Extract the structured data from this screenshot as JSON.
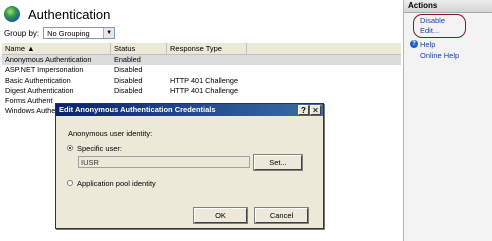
{
  "header": {
    "title": "Authentication",
    "icon": "globe-icon"
  },
  "toolbar": {
    "group_by_label": "Group by:",
    "group_by_value": "No Grouping"
  },
  "table": {
    "columns": [
      "Name",
      "Status",
      "Response Type"
    ],
    "rows": [
      {
        "name": "Anonymous Authentication",
        "status": "Enabled",
        "response": ""
      },
      {
        "name": "ASP.NET Impersonation",
        "status": "Disabled",
        "response": ""
      },
      {
        "name": "Basic Authentication",
        "status": "Disabled",
        "response": "HTTP 401 Challenge"
      },
      {
        "name": "Digest Authentication",
        "status": "Disabled",
        "response": "HTTP 401 Challenge"
      },
      {
        "name": "Forms Authent",
        "status": "",
        "response": ""
      },
      {
        "name": "Windows Authe",
        "status": "",
        "response": ""
      }
    ]
  },
  "actions": {
    "header": "Actions",
    "items": [
      "Disable",
      "Edit...",
      "Help",
      "Online Help"
    ]
  },
  "dialog": {
    "title": "Edit Anonymous Authentication Credentials",
    "help_btn": "?",
    "close_btn": "✕",
    "identity_label": "Anonymous user identity:",
    "specific_user_label": "Specific user:",
    "specific_user_value": "IUSR",
    "set_button": "Set...",
    "app_pool_label": "Application pool identity",
    "ok_button": "OK",
    "cancel_button": "Cancel"
  },
  "colors": {
    "accent": "#0a246a",
    "link": "#1a3fa8",
    "highlight_oval": "#7a1d1d"
  }
}
